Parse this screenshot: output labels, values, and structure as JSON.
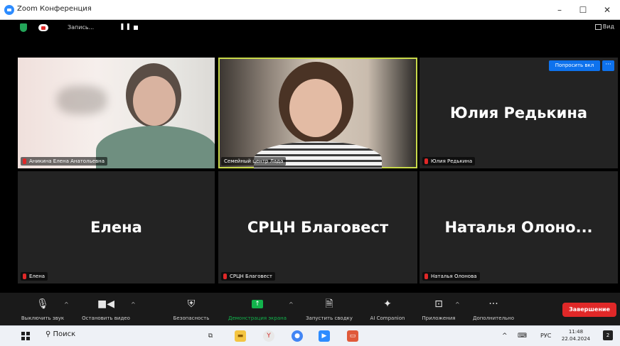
{
  "window": {
    "title": "Zoom Конференция",
    "minimize": "–",
    "maximize": "☐",
    "close": "✕"
  },
  "top_bar": {
    "recording_label": "Запись...",
    "pause_glyph": "❚❚",
    "view_label": "Вид"
  },
  "tiles": [
    {
      "label": "Аникина Елена Анатольевна",
      "big_name": ""
    },
    {
      "label": "Семейный центр Лада",
      "big_name": ""
    },
    {
      "label": "Юлия Редькина",
      "big_name": "Юлия Редькина"
    },
    {
      "label": "Елена",
      "big_name": "Елена"
    },
    {
      "label": "СРЦН Благовест",
      "big_name": "СРЦН Благовест"
    },
    {
      "label": "Наталья Олонова",
      "big_name": "Наталья  Олоно..."
    }
  ],
  "ask_button": {
    "label": "Попросить вкл",
    "more": "···"
  },
  "controls": {
    "mute": "Выключить звук",
    "video": "Остановить видео",
    "security": "Безопасность",
    "share": "Демонстрация экрана",
    "summary": "Запустить сводку",
    "ai": "AI Companion",
    "apps": "Приложения",
    "more": "Дополнительно",
    "end": "Завершение"
  },
  "colors": {
    "share_label": "#12b34c",
    "end_button": "#e02828",
    "ask_button": "#0e72ed",
    "active_speaker": "#c8d94a"
  },
  "taskbar": {
    "search_placeholder": "Поиск",
    "language": "РУС",
    "time": "11:48",
    "date": "22.04.2024",
    "notifications": "2",
    "chevron": "^"
  }
}
